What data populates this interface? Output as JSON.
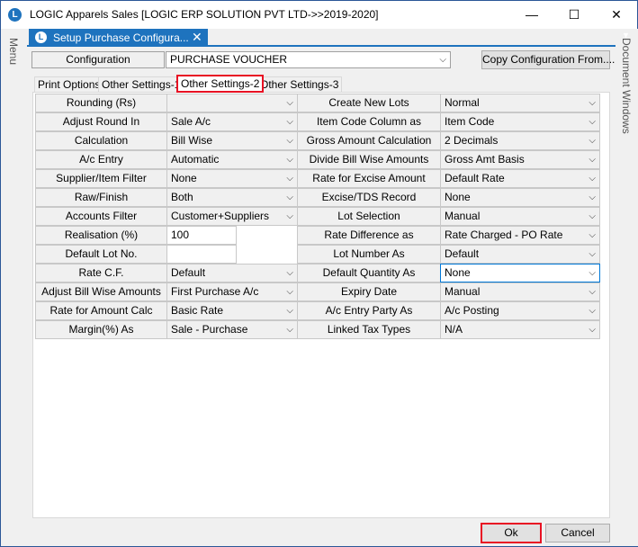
{
  "window": {
    "title": "LOGIC Apparels Sales  [LOGIC ERP SOLUTION PVT LTD->>2019-2020]",
    "icon": "logic-app-icon",
    "controls": {
      "minimize": "—",
      "maximize": "☐",
      "close": "✕"
    }
  },
  "left_rail": {
    "label": "Menu"
  },
  "right_rail": {
    "label": "Document Windows"
  },
  "doc_tab": {
    "label": "Setup Purchase Configura...",
    "close": "✕",
    "dropdown": "▼"
  },
  "config": {
    "label": "Configuration",
    "value": "PURCHASE VOUCHER",
    "copy_button": "Copy Configuration From...."
  },
  "tabs": [
    {
      "label": "Print Options"
    },
    {
      "label": "Other Settings-1"
    },
    {
      "label": "Other Settings-2"
    },
    {
      "label": "Other Settings-3"
    }
  ],
  "active_tab": "Other Settings-2",
  "left_rows": [
    {
      "label": "Rounding  (Rs)",
      "value": "",
      "kind": "combo"
    },
    {
      "label": "Adjust Round In",
      "value": "Sale A/c",
      "kind": "combo"
    },
    {
      "label": "Calculation",
      "value": "Bill Wise",
      "kind": "combo"
    },
    {
      "label": "A/c Entry",
      "value": "Automatic",
      "kind": "combo"
    },
    {
      "label": "Supplier/Item Filter",
      "value": "None",
      "kind": "combo"
    },
    {
      "label": "Raw/Finish",
      "value": "Both",
      "kind": "combo"
    },
    {
      "label": "Accounts Filter",
      "value": "Customer+Suppliers",
      "kind": "combo"
    },
    {
      "label": "Realisation (%)",
      "value": "100",
      "kind": "text"
    },
    {
      "label": "Default Lot No.",
      "value": "",
      "kind": "text"
    },
    {
      "label": "Rate C.F.",
      "value": "Default",
      "kind": "combo"
    },
    {
      "label": "Adjust Bill Wise Amounts",
      "value": "First Purchase A/c",
      "kind": "combo"
    },
    {
      "label": "Rate for Amount Calc",
      "value": "Basic Rate",
      "kind": "combo"
    },
    {
      "label": "Margin(%) As",
      "value": "Sale - Purchase",
      "kind": "combo"
    }
  ],
  "right_rows": [
    {
      "label": "Create New Lots",
      "value": "Normal"
    },
    {
      "label": "Item Code Column as",
      "value": "Item Code"
    },
    {
      "label": "Gross Amount Calculation",
      "value": "2 Decimals"
    },
    {
      "label": "Divide Bill Wise Amounts",
      "value": "Gross Amt Basis"
    },
    {
      "label": "Rate for Excise Amount",
      "value": "Default Rate"
    },
    {
      "label": "Excise/TDS Record",
      "value": "None"
    },
    {
      "label": "Lot Selection",
      "value": "Manual"
    },
    {
      "label": "Rate Difference as",
      "value": "Rate Charged - PO Rate"
    },
    {
      "label": "Lot Number As",
      "value": "Default"
    },
    {
      "label": "Default Quantity As",
      "value": "None"
    },
    {
      "label": "Expiry Date",
      "value": "Manual"
    },
    {
      "label": "A/c Entry Party As",
      "value": "A/c Posting"
    },
    {
      "label": "Linked Tax Types",
      "value": "N/A"
    }
  ],
  "buttons": {
    "ok": "Ok",
    "cancel": "Cancel"
  },
  "colors": {
    "accent": "#1e73be",
    "highlight": "#e81123",
    "focus": "#0078d7"
  }
}
